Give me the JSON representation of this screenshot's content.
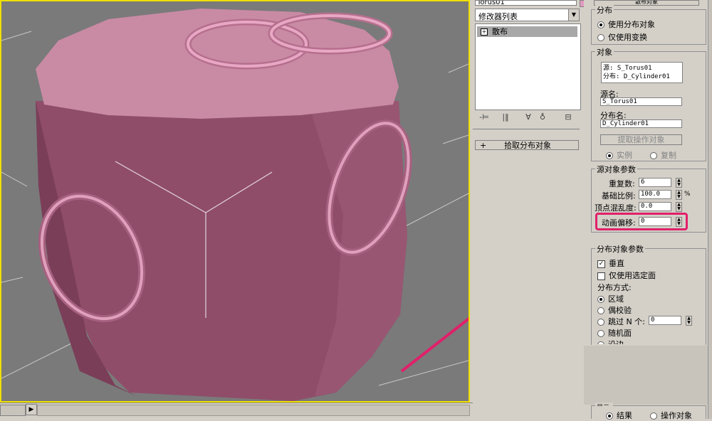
{
  "viewport": {
    "scene": "3D viewport: cylinder with torus objects"
  },
  "middle_panel": {
    "object_name": "Torus01",
    "object_color": "#e29ac0",
    "modifier_list_label": "修改器列表",
    "stack_item": "散布",
    "stack_tools": [
      "-⊨",
      "|‖",
      "∀",
      "♁",
      "⊟"
    ],
    "pick_button": "拾取分布对象",
    "pick_pm": "+"
  },
  "right_panel": {
    "top_button": "散布对象",
    "distribution_group": {
      "title": "分布",
      "use_distribution_object": "使用分布对象",
      "use_transform_only": "仅使用变换"
    },
    "object_group": {
      "title": "对象",
      "info_line1": "源: S_Torus01",
      "info_line2": "分布: D_Cylinder01",
      "source_name_label": "源名:",
      "source_name_value": "S_Torus01",
      "distribution_name_label": "分布名:",
      "distribution_name_value": "D_Cylinder01",
      "extract_button": "提取操作对象",
      "instance": "实例",
      "copy": "复制"
    },
    "source_params": {
      "title": "源对象参数",
      "duplicates_label": "重复数:",
      "duplicates_value": "6",
      "base_scale_label": "基础比例:",
      "base_scale_value": "100.0",
      "base_scale_unit": "%",
      "vertex_chaos_label": "顶点混乱度:",
      "vertex_chaos_value": "0.0",
      "anim_offset_label": "动画偏移:",
      "anim_offset_value": "0"
    },
    "distribution_params": {
      "title": "分布对象参数",
      "perpendicular": "垂直",
      "use_selected_faces": "仅使用选定面",
      "method_label": "分布方式:",
      "area": "区域",
      "even": "偶校验",
      "skip_n_label": "跳过 N 个:",
      "skip_n_value": "0",
      "random_faces": "随机面",
      "along_edges": "沿边"
    },
    "display_group": {
      "title": "显示:",
      "result": "结果",
      "operands": "操作对象"
    }
  },
  "colors": {
    "highlight": "#e0206a",
    "viewport_border": "#f0e000",
    "object_pink": "#c98aa4"
  }
}
